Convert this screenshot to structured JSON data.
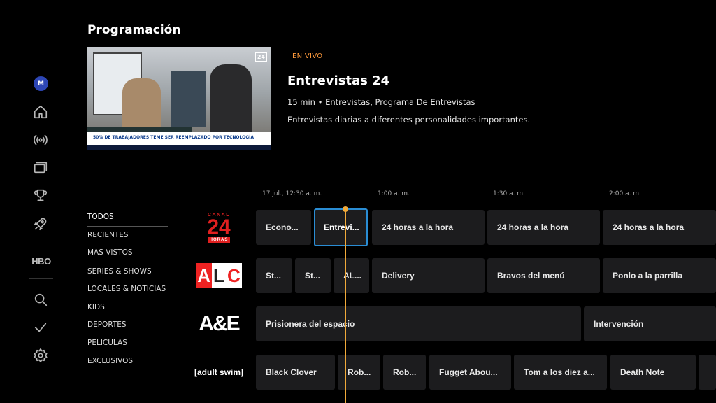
{
  "page": {
    "title": "Programación"
  },
  "sidebar": {
    "avatar_initial": "M",
    "icons": [
      "home-icon",
      "live-icon",
      "library-icon",
      "trophy-icon",
      "rocket-icon",
      "hbo-logo",
      "search-icon",
      "check-icon",
      "gear-icon"
    ],
    "hbo_label": "HBO"
  },
  "preview": {
    "live_label": "EN VIVO",
    "title": "Entrevistas 24",
    "meta": "15 min • Entrevistas, Programa De Entrevistas",
    "description": "Entrevistas diarias a diferentes personalidades importantes.",
    "ticker": "50% DE TRABAJADORES TEME SER REEMPLAZADO POR TECNOLOGÍA",
    "logo": "24"
  },
  "timeline": {
    "times": [
      "17 jul., 12:30 a. m.",
      "1:00 a. m.",
      "1:30 a. m.",
      "2:00 a. m."
    ]
  },
  "categories": [
    "TODOS",
    "RECIENTES",
    "MÁS VISTOS",
    "SERIES & SHOWS",
    "LOCALES & NOTICIAS",
    "KIDS",
    "DEPORTES",
    "PELICULAS",
    "EXCLUSIVOS"
  ],
  "channels": [
    {
      "name": "Canal 24 Horas",
      "logo_top": "CANAL",
      "logo_mid": "24",
      "logo_bot": "HORAS",
      "programs": [
        "Econo...",
        "Entrevi...",
        "24 horas a la hora",
        "24 horas a la hora",
        "24 horas a la hora"
      ]
    },
    {
      "name": "ALC",
      "logo_a": "A",
      "logo_l": "L",
      "logo_c": "C",
      "programs": [
        "St...",
        "St...",
        "AL...",
        "Delivery",
        "Bravos del menú",
        "Ponlo a la parrilla"
      ]
    },
    {
      "name": "A&E",
      "logo": "A&E",
      "programs": [
        "Prisionera del espacio",
        "Intervención"
      ]
    },
    {
      "name": "Adult Swim",
      "logo": "[adult swim]",
      "programs": [
        "Black Clover",
        "Rob...",
        "Rob...",
        "Fugget Abou...",
        "Tom a los diez a...",
        "Death Note"
      ]
    }
  ],
  "colors": {
    "accent": "#f0a93a",
    "focus": "#2a8dd4",
    "live": "#ff9a3c"
  }
}
